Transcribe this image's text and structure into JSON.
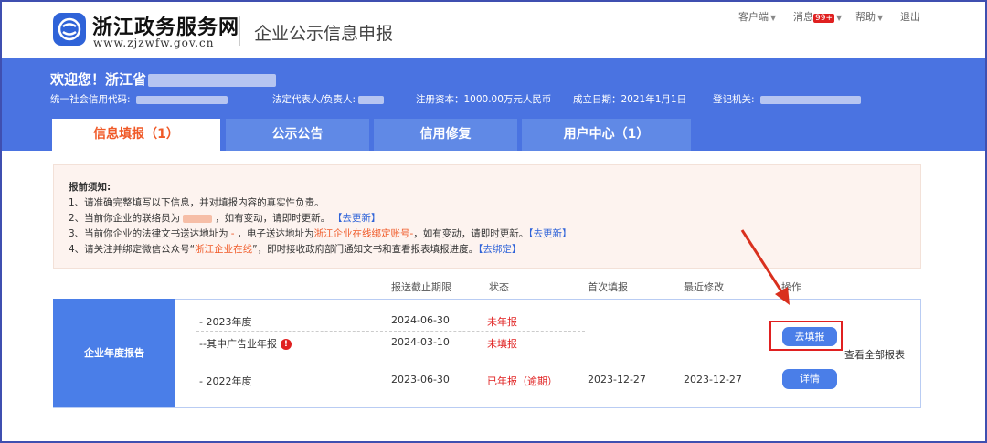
{
  "header": {
    "logo_title": "浙江政务服务网",
    "logo_url_text": "www.zjzwfw.gov.cn",
    "system_title": "企业公示信息申报",
    "nav": {
      "client": "客户端",
      "messages": "消息",
      "messages_badge": "99+",
      "help": "帮助",
      "logout": "退出"
    }
  },
  "banner": {
    "welcome": "欢迎您！浙江省",
    "credit_code_label": "统一社会信用代码:",
    "legal_rep_label": "法定代表人/负责人:",
    "registered_capital": "注册资本：1000.00万元人民币",
    "established_date": "成立日期：2021年1月1日",
    "registration_authority_label": "登记机关:"
  },
  "tabs": [
    {
      "label": "信息填报（1）",
      "active": true
    },
    {
      "label": "公示公告",
      "active": false
    },
    {
      "label": "信用修复",
      "active": false
    },
    {
      "label": "用户中心（1）",
      "active": false
    }
  ],
  "notice": {
    "title": "报前须知:",
    "line1": "1、请准确完整填写以下信息，并对填报内容的真实性负责。",
    "line2_pre": "2、当前你企业的联络员为",
    "line2_post": "，如有变动，请即时更新。",
    "line2_link": "【去更新】",
    "line3_pre": "3、当前你企业的法律文书送达地址为",
    "line3_dash": "-",
    "line3_mid": "，电子送达地址为",
    "line3_orange": "浙江企业在线绑定账号-",
    "line3_post": "，如有变动，请即时更新。",
    "line3_link": "【去更新】",
    "line4_pre": "4、请关注并绑定微信公众号“",
    "line4_orange": "浙江企业在线",
    "line4_post": "”，即时接收政府部门通知文书和查看报表填报进度。",
    "line4_link": "【去绑定】"
  },
  "table": {
    "headers": [
      "报送截止期限",
      "状态",
      "首次填报",
      "最近修改",
      "操作"
    ],
    "row_group": "企业年度报告",
    "rows": [
      {
        "name": "- 2023年度",
        "deadline": "2024-06-30",
        "status": "未年报",
        "first": "",
        "last": ""
      },
      {
        "name": "--其中广告业年报",
        "deadline": "2024-03-10",
        "status": "未填报",
        "first": "",
        "last": ""
      },
      {
        "name": "- 2022年度",
        "deadline": "2023-06-30",
        "status": "已年报（逾期）",
        "first": "2023-12-27",
        "last": "2023-12-27"
      }
    ],
    "fill_button": "去填报",
    "detail_button": "详情",
    "view_all": "查看全部报表"
  },
  "colors": {
    "banner_blue": "#4a73e1",
    "tab_orange": "#f05a28",
    "status_red": "#e02020",
    "button_blue": "#4a7ee8"
  }
}
